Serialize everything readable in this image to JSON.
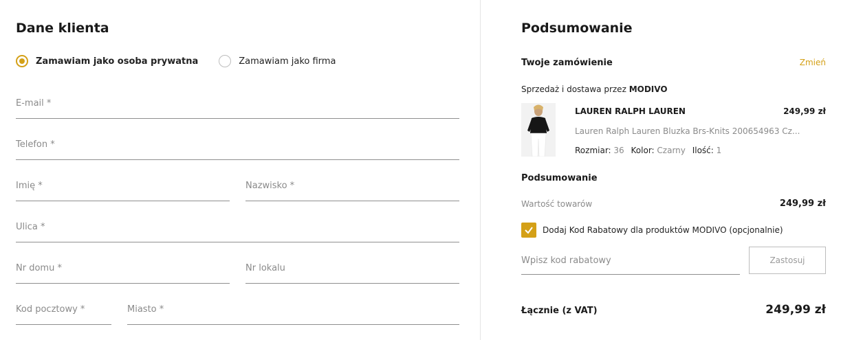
{
  "customer": {
    "title": "Dane klienta",
    "radio_private": "Zamawiam jako osoba prywatna",
    "radio_company": "Zamawiam jako firma",
    "fields": {
      "email": "E-mail *",
      "phone": "Telefon *",
      "first_name": "Imię *",
      "last_name": "Nazwisko *",
      "street": "Ulica *",
      "house_no": "Nr domu *",
      "flat_no": "Nr lokalu",
      "postal_code": "Kod pocztowy *",
      "city": "Miasto *"
    }
  },
  "summary": {
    "title": "Podsumowanie",
    "your_order": "Twoje zamówienie",
    "change": "Zmień",
    "sold_by_prefix": "Sprzedaż i dostawa przez",
    "sold_by_brand": "MODIVO",
    "product": {
      "brand": "LAUREN RALPH LAUREN",
      "price": "249,99 zł",
      "name": "Lauren Ralph Lauren Bluzka Brs-Knits 200654963 Cz...",
      "size_label": "Rozmiar:",
      "size_value": "36",
      "color_label": "Kolor:",
      "color_value": "Czarny",
      "qty_label": "Ilość:",
      "qty_value": "1"
    },
    "subtitle": "Podsumowanie",
    "goods_value_label": "Wartość towarów",
    "goods_value": "249,99 zł",
    "discount_checkbox_label": "Dodaj Kod Rabatowy dla produktów MODIVO (opcjonalnie)",
    "discount_placeholder": "Wpisz kod rabatowy",
    "apply_label": "Zastosuj",
    "total_label": "Łącznie (z VAT)",
    "total_value": "249,99 zł"
  },
  "colors": {
    "accent": "#d4a017"
  }
}
